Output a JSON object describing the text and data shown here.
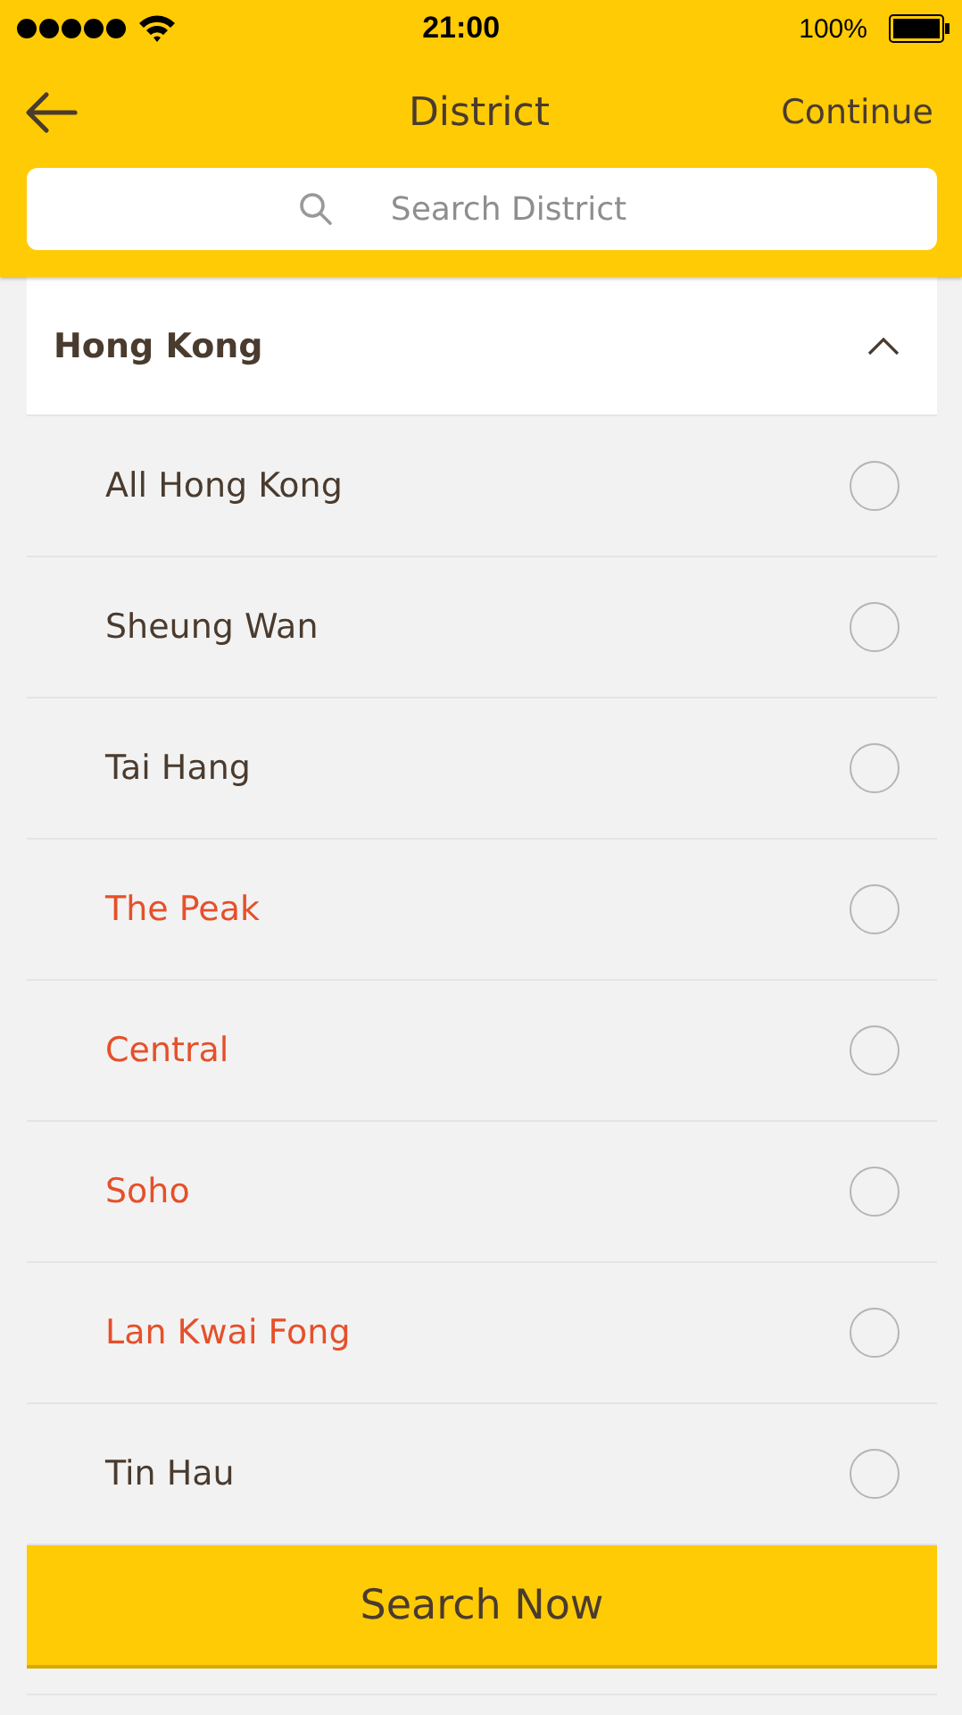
{
  "status_bar": {
    "time": "21:00",
    "battery": "100%"
  },
  "nav": {
    "title": "District",
    "action": "Continue"
  },
  "search": {
    "placeholder": "Search District"
  },
  "group": {
    "title": "Hong Kong",
    "expanded": true,
    "items": [
      {
        "label": "All Hong Kong",
        "color": "#4a3b2f",
        "selected": false
      },
      {
        "label": "Sheung Wan",
        "color": "#4a3b2f",
        "selected": false
      },
      {
        "label": "Tai Hang",
        "color": "#4a3b2f",
        "selected": false
      },
      {
        "label": "The Peak",
        "color": "#e5502a",
        "selected": false
      },
      {
        "label": "Central",
        "color": "#e5502a",
        "selected": false
      },
      {
        "label": "Soho",
        "color": "#e5502a",
        "selected": false
      },
      {
        "label": "Lan Kwai Fong",
        "color": "#e5502a",
        "selected": false
      },
      {
        "label": "Tin Hau",
        "color": "#4a3b2f",
        "selected": false
      }
    ]
  },
  "primary_button": "Search Now"
}
